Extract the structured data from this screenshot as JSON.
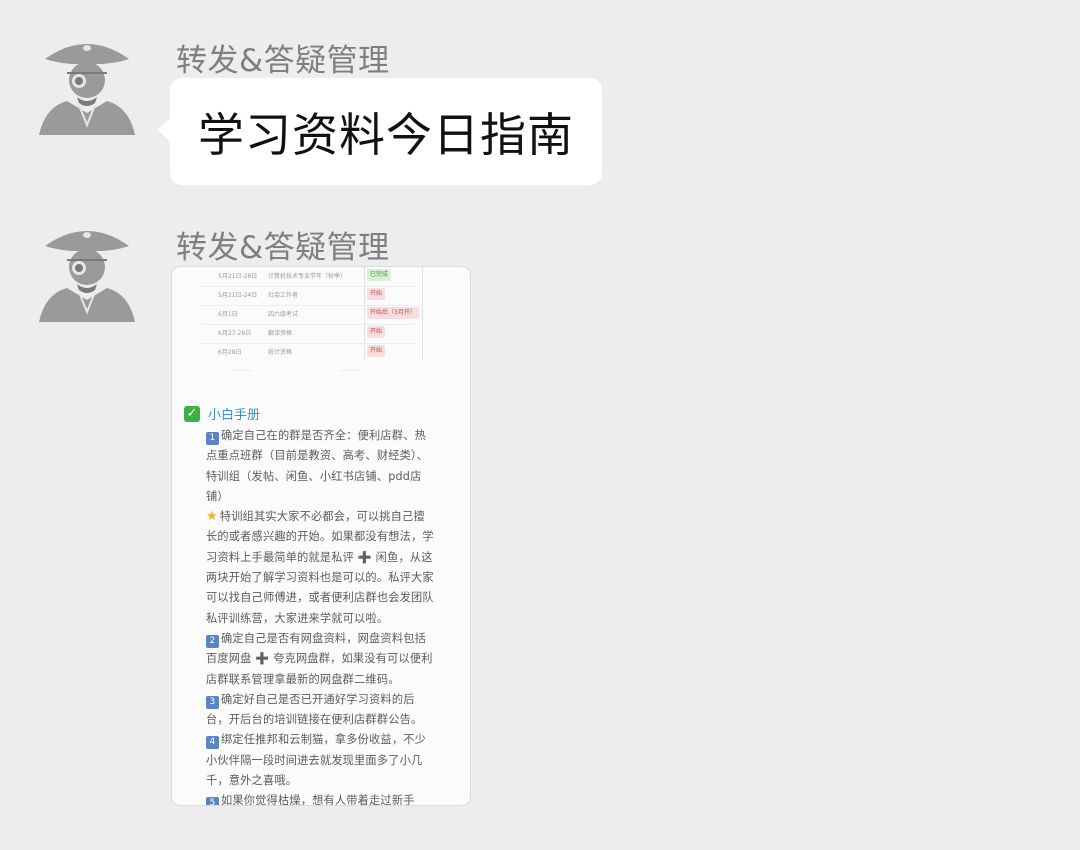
{
  "messages": [
    {
      "sender": "转发&答疑管理",
      "type": "text",
      "text": "学习资料今日指南"
    },
    {
      "sender": "转发&答疑管理",
      "type": "image",
      "image": {
        "table_rows": [
          {
            "date": "5月21日-28日",
            "task": "计算机技术专业学年（秋季）",
            "tag": "已完成",
            "tag_color": "#d9f0d9",
            "tag_text_color": "#3c9a3c"
          },
          {
            "date": "5月21日-24日",
            "task": "社会工作者",
            "tag": "开始",
            "tag_color": "#f7dede",
            "tag_text_color": "#c05050"
          },
          {
            "date": "6月1日",
            "task": "四六级考试",
            "tag": "开始后（3月开）",
            "tag_color": "#f7dede",
            "tag_text_color": "#c05050"
          },
          {
            "date": "6月27-28日",
            "task": "翻译资格",
            "tag": "开始",
            "tag_color": "#f7dede",
            "tag_text_color": "#c05050"
          },
          {
            "date": "6月28日",
            "task": "统计资格",
            "tag": "开始",
            "tag_color": "#f7dede",
            "tag_text_color": "#c05050"
          }
        ],
        "section_title": "小白手册",
        "paragraphs": [
          {
            "marker": "1",
            "lines": [
              "确定自己在的群是否齐全：便利店群、热",
              "点重点班群（目前是教资、高考、财经类）、",
              "特训组（发帖、闲鱼、小红书店铺、pdd店",
              "铺）"
            ]
          },
          {
            "marker": "star",
            "lines": [
              "特训组其实大家不必都会，可以挑自己擅",
              "长的或者感兴趣的开始。如果都没有想法，学",
              "习资料上手最简单的就是私评 ➕ 闲鱼，从这",
              "两块开始了解学习资料也是可以的。私评大家",
              "可以找自己师傅进，或者便利店群也会发团队",
              "私评训练营，大家进来学就可以啦。"
            ]
          },
          {
            "marker": "2",
            "lines": [
              "确定自己是否有网盘资料，网盘资料包括",
              "百度网盘 ➕ 夸克网盘群，如果没有可以便利",
              "店群联系管理拿最新的网盘群二维码。"
            ]
          },
          {
            "marker": "3",
            "lines": [
              "确定好自己是否已开通好学习资料的后",
              "台，开后台的培训链接在便利店群群公告。"
            ]
          },
          {
            "marker": "4",
            "lines": [
              "绑定任推邦和云制猫，拿多份收益，不少",
              "小伙伴隔一段时间进去就发现里面多了小几",
              "千，意外之喜哦。"
            ]
          },
          {
            "marker": "5",
            "lines": [
              "如果你觉得枯燥，想有人带着走过新手"
            ]
          }
        ]
      }
    }
  ],
  "colors": {
    "background": "#ededed",
    "bubble": "#ffffff",
    "sender_text": "#7f7f7f",
    "accent_blue": "#3a8fd9"
  }
}
